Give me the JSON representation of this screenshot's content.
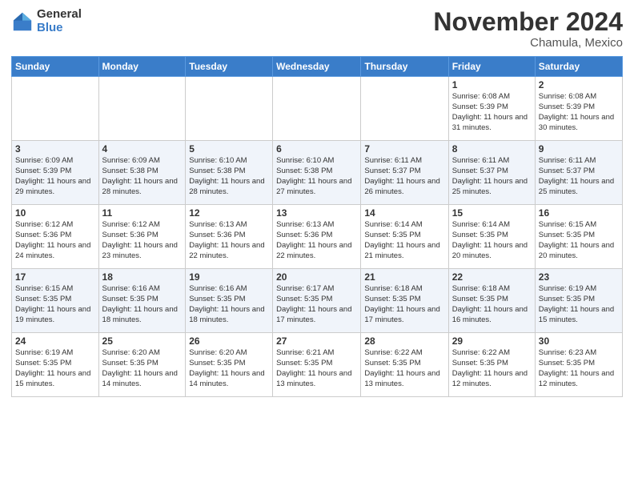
{
  "logo": {
    "general": "General",
    "blue": "Blue"
  },
  "header": {
    "month": "November 2024",
    "location": "Chamula, Mexico"
  },
  "weekdays": [
    "Sunday",
    "Monday",
    "Tuesday",
    "Wednesday",
    "Thursday",
    "Friday",
    "Saturday"
  ],
  "weeks": [
    [
      {
        "day": "",
        "info": ""
      },
      {
        "day": "",
        "info": ""
      },
      {
        "day": "",
        "info": ""
      },
      {
        "day": "",
        "info": ""
      },
      {
        "day": "",
        "info": ""
      },
      {
        "day": "1",
        "info": "Sunrise: 6:08 AM\nSunset: 5:39 PM\nDaylight: 11 hours\nand 31 minutes."
      },
      {
        "day": "2",
        "info": "Sunrise: 6:08 AM\nSunset: 5:39 PM\nDaylight: 11 hours\nand 30 minutes."
      }
    ],
    [
      {
        "day": "3",
        "info": "Sunrise: 6:09 AM\nSunset: 5:39 PM\nDaylight: 11 hours\nand 29 minutes."
      },
      {
        "day": "4",
        "info": "Sunrise: 6:09 AM\nSunset: 5:38 PM\nDaylight: 11 hours\nand 28 minutes."
      },
      {
        "day": "5",
        "info": "Sunrise: 6:10 AM\nSunset: 5:38 PM\nDaylight: 11 hours\nand 28 minutes."
      },
      {
        "day": "6",
        "info": "Sunrise: 6:10 AM\nSunset: 5:38 PM\nDaylight: 11 hours\nand 27 minutes."
      },
      {
        "day": "7",
        "info": "Sunrise: 6:11 AM\nSunset: 5:37 PM\nDaylight: 11 hours\nand 26 minutes."
      },
      {
        "day": "8",
        "info": "Sunrise: 6:11 AM\nSunset: 5:37 PM\nDaylight: 11 hours\nand 25 minutes."
      },
      {
        "day": "9",
        "info": "Sunrise: 6:11 AM\nSunset: 5:37 PM\nDaylight: 11 hours\nand 25 minutes."
      }
    ],
    [
      {
        "day": "10",
        "info": "Sunrise: 6:12 AM\nSunset: 5:36 PM\nDaylight: 11 hours\nand 24 minutes."
      },
      {
        "day": "11",
        "info": "Sunrise: 6:12 AM\nSunset: 5:36 PM\nDaylight: 11 hours\nand 23 minutes."
      },
      {
        "day": "12",
        "info": "Sunrise: 6:13 AM\nSunset: 5:36 PM\nDaylight: 11 hours\nand 22 minutes."
      },
      {
        "day": "13",
        "info": "Sunrise: 6:13 AM\nSunset: 5:36 PM\nDaylight: 11 hours\nand 22 minutes."
      },
      {
        "day": "14",
        "info": "Sunrise: 6:14 AM\nSunset: 5:35 PM\nDaylight: 11 hours\nand 21 minutes."
      },
      {
        "day": "15",
        "info": "Sunrise: 6:14 AM\nSunset: 5:35 PM\nDaylight: 11 hours\nand 20 minutes."
      },
      {
        "day": "16",
        "info": "Sunrise: 6:15 AM\nSunset: 5:35 PM\nDaylight: 11 hours\nand 20 minutes."
      }
    ],
    [
      {
        "day": "17",
        "info": "Sunrise: 6:15 AM\nSunset: 5:35 PM\nDaylight: 11 hours\nand 19 minutes."
      },
      {
        "day": "18",
        "info": "Sunrise: 6:16 AM\nSunset: 5:35 PM\nDaylight: 11 hours\nand 18 minutes."
      },
      {
        "day": "19",
        "info": "Sunrise: 6:16 AM\nSunset: 5:35 PM\nDaylight: 11 hours\nand 18 minutes."
      },
      {
        "day": "20",
        "info": "Sunrise: 6:17 AM\nSunset: 5:35 PM\nDaylight: 11 hours\nand 17 minutes."
      },
      {
        "day": "21",
        "info": "Sunrise: 6:18 AM\nSunset: 5:35 PM\nDaylight: 11 hours\nand 17 minutes."
      },
      {
        "day": "22",
        "info": "Sunrise: 6:18 AM\nSunset: 5:35 PM\nDaylight: 11 hours\nand 16 minutes."
      },
      {
        "day": "23",
        "info": "Sunrise: 6:19 AM\nSunset: 5:35 PM\nDaylight: 11 hours\nand 15 minutes."
      }
    ],
    [
      {
        "day": "24",
        "info": "Sunrise: 6:19 AM\nSunset: 5:35 PM\nDaylight: 11 hours\nand 15 minutes."
      },
      {
        "day": "25",
        "info": "Sunrise: 6:20 AM\nSunset: 5:35 PM\nDaylight: 11 hours\nand 14 minutes."
      },
      {
        "day": "26",
        "info": "Sunrise: 6:20 AM\nSunset: 5:35 PM\nDaylight: 11 hours\nand 14 minutes."
      },
      {
        "day": "27",
        "info": "Sunrise: 6:21 AM\nSunset: 5:35 PM\nDaylight: 11 hours\nand 13 minutes."
      },
      {
        "day": "28",
        "info": "Sunrise: 6:22 AM\nSunset: 5:35 PM\nDaylight: 11 hours\nand 13 minutes."
      },
      {
        "day": "29",
        "info": "Sunrise: 6:22 AM\nSunset: 5:35 PM\nDaylight: 11 hours\nand 12 minutes."
      },
      {
        "day": "30",
        "info": "Sunrise: 6:23 AM\nSunset: 5:35 PM\nDaylight: 11 hours\nand 12 minutes."
      }
    ]
  ]
}
